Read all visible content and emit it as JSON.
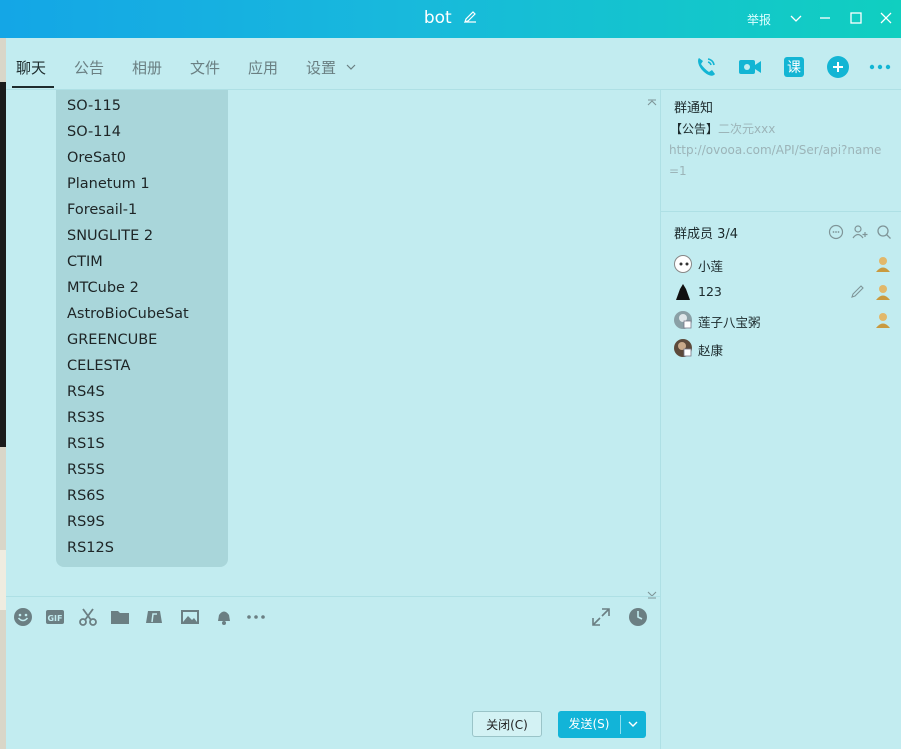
{
  "window": {
    "title": "bot",
    "report_label": "举报"
  },
  "tabs": [
    {
      "label": "聊天"
    },
    {
      "label": "公告"
    },
    {
      "label": "相册"
    },
    {
      "label": "文件"
    },
    {
      "label": "应用"
    },
    {
      "label": "设置"
    }
  ],
  "header_icons": [
    "phone-icon",
    "video-icon",
    "class-icon",
    "add-app-icon",
    "more-icon"
  ],
  "message": {
    "lines": [
      "SO-115",
      "SO-114",
      "OreSat0",
      "Planetum 1",
      "Foresail-1",
      "SNUGLITE 2",
      "CTIM",
      "MTCube 2",
      "AstroBioCubeSat",
      "GREENCUBE",
      "CELESTA",
      "RS4S",
      "RS3S",
      "RS1S",
      "RS5S",
      "RS6S",
      "RS9S",
      "RS12S"
    ]
  },
  "toolbar_icons": [
    "emoji-icon",
    "gif-icon",
    "scissors-icon",
    "folder-icon",
    "music-icon",
    "image-icon",
    "bell-icon",
    "more-icon",
    "expand-icon",
    "clock-icon"
  ],
  "buttons": {
    "close": "关闭(C)",
    "send": "发送(S)"
  },
  "notice": {
    "title": "群通知",
    "tag": "【公告】",
    "subtitle": "二次元xxx",
    "url": "http://ovooa.com/API/Ser/api?name=1"
  },
  "members": {
    "title": "群成员 3/4",
    "list": [
      {
        "name": "小莲"
      },
      {
        "name": "123"
      },
      {
        "name": "莲子八宝粥"
      },
      {
        "name": "赵康"
      }
    ]
  },
  "colors": {
    "title_gradient_start": "#14a6e6",
    "title_gradient_end": "#10cfc0",
    "accent": "#12b4d8",
    "background": "#c2ecf0"
  }
}
